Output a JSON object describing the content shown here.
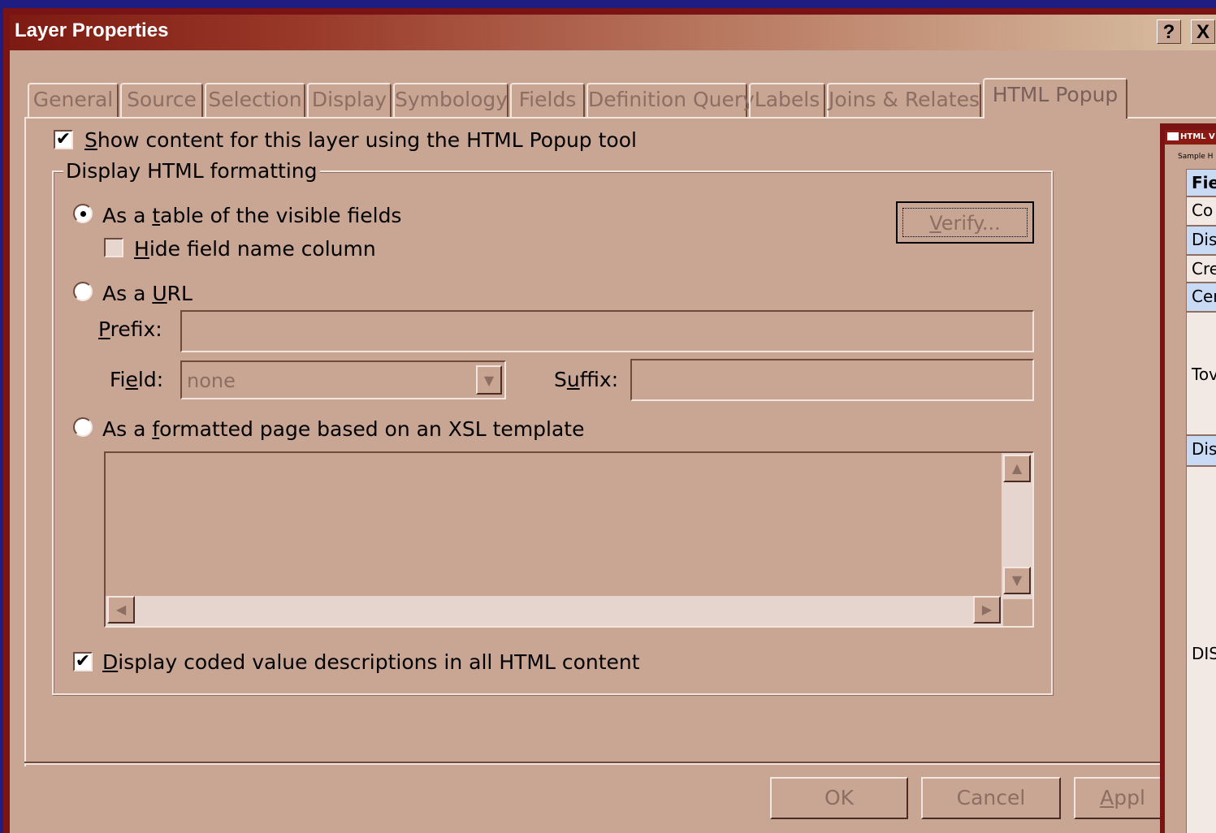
{
  "dialog": {
    "title": "Layer Properties",
    "help_glyph": "?",
    "close_glyph": "X"
  },
  "tabs": [
    {
      "label": "General"
    },
    {
      "label": "Source"
    },
    {
      "label": "Selection"
    },
    {
      "label": "Display"
    },
    {
      "label": "Symbology"
    },
    {
      "label": "Fields"
    },
    {
      "label": "Definition Query"
    },
    {
      "label": "Labels"
    },
    {
      "label": "Joins & Relates"
    },
    {
      "label": "HTML Popup",
      "active": true
    }
  ],
  "panel": {
    "show_content": {
      "checked": true,
      "check_glyph": "✔",
      "underlined": "S",
      "rest": "how content for this layer using the HTML Popup tool"
    },
    "group_label": "Display HTML formatting",
    "option_table": {
      "selected": true,
      "pre": "As a ",
      "underlined": "t",
      "post": "able of the visible fields"
    },
    "hide_field_name": {
      "checked": false,
      "underlined": "H",
      "rest": "ide field name column"
    },
    "option_url": {
      "selected": false,
      "pre": "As a ",
      "underlined": "U",
      "post": "RL"
    },
    "prefix": {
      "underlined": "P",
      "rest": "refix:",
      "value": ""
    },
    "field": {
      "pre": "Fi",
      "underlined": "e",
      "post": "ld:",
      "value": "none"
    },
    "suffix": {
      "pre": "S",
      "underlined": "u",
      "post": "ffix:",
      "value": ""
    },
    "option_xsl": {
      "selected": false,
      "pre": "As a ",
      "underlined": "f",
      "post": "ormatted page based on an XSL template"
    },
    "verify_button": {
      "underlined": "V",
      "rest": "erify..."
    },
    "display_coded": {
      "checked": true,
      "check_glyph": "✔",
      "underlined": "D",
      "rest": "isplay coded value descriptions in all HTML content"
    }
  },
  "buttons": {
    "ok": "OK",
    "cancel": "Cancel",
    "apply_underlined": "A",
    "apply_rest": "ppl"
  },
  "popup_window": {
    "title": "HTML V",
    "subtitle": "Sample H",
    "rows": [
      {
        "text": "Fie",
        "style": "hdr"
      },
      {
        "text": "Co",
        "style": "plain"
      },
      {
        "text": "Dis",
        "style": "hl"
      },
      {
        "text": "Cre",
        "style": "plain"
      },
      {
        "text": "Cer",
        "style": "hl"
      },
      {
        "text": "Tov",
        "style": "plain"
      },
      {
        "text": "Dis",
        "style": "hl"
      },
      {
        "text": "DIS",
        "style": "plain"
      }
    ]
  }
}
